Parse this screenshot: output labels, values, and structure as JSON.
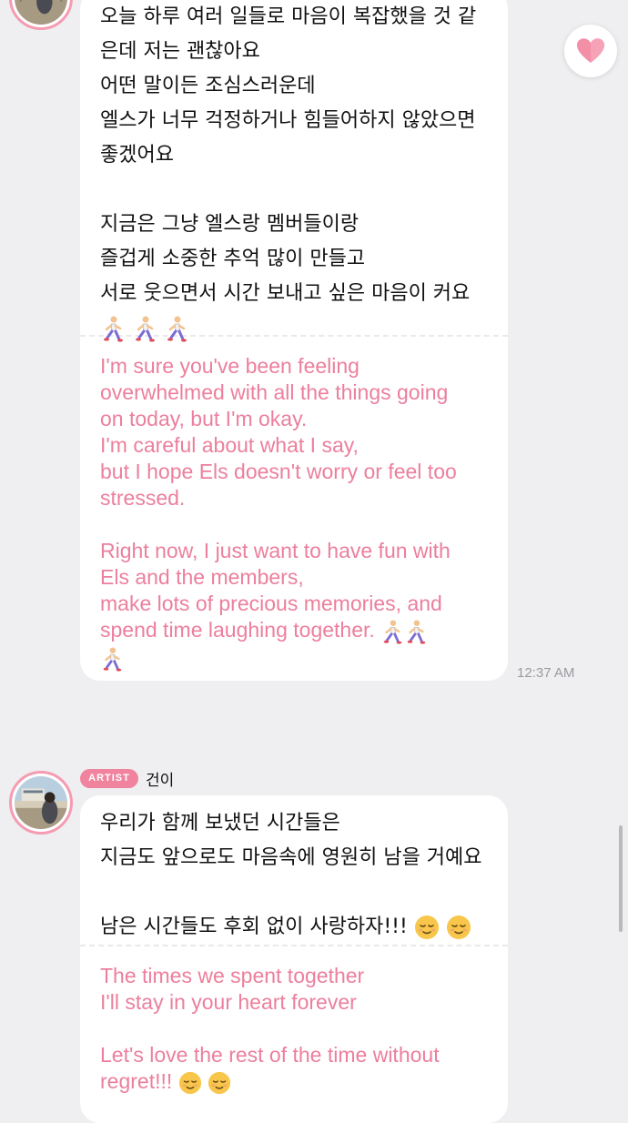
{
  "colors": {
    "background": "#efeff1",
    "bubble": "#ffffff",
    "translation_text": "#ec7f9d",
    "accent_pink": "#f0849f",
    "timestamp": "#9a9aa0"
  },
  "icons": {
    "heart": "heart-icon",
    "runner": "person-running-emoji",
    "relieved": "relieved-face-emoji"
  },
  "message1": {
    "korean_1": "오늘 하루 여러 일들로 마음이 복잡했을 것 같",
    "korean_2": "은데 저는 괜찮아요",
    "korean_3": "어떤 말이든 조심스러운데",
    "korean_4": "엘스가 너무 걱정하거나 힘들어하지 않았으면",
    "korean_5": "좋겠어요",
    "korean_6": "지금은 그냥 엘스랑 멤버들이랑",
    "korean_7": "즐겁게 소중한 추억 많이 만들고",
    "korean_8": "서로 웃으면서 시간 보내고 싶은 마음이 커요",
    "english_1": "I'm sure you've been feeling",
    "english_2": "overwhelmed with all the things going",
    "english_3": "on today, but I'm okay.",
    "english_4": "I'm careful about what I say,",
    "english_5": "but I hope Els doesn't worry or feel too",
    "english_6": "stressed.",
    "english_7": "Right now, I just want to have fun with",
    "english_8": "Els and the members,",
    "english_9": "make lots of precious memories, and",
    "english_10": "spend time laughing together.",
    "timestamp": "12:37 AM"
  },
  "message2": {
    "badge": "ARTIST",
    "sender": "건이",
    "korean_1": "우리가 함께 보냈던 시간들은",
    "korean_2": "지금도 앞으로도 마음속에 영원히 남을 거예요",
    "korean_3": "남은 시간들도 후회 없이 사랑하자!!!",
    "english_1": "The times we spent together",
    "english_2": "I'll stay in your heart forever",
    "english_3": "Let's love the rest of the time without",
    "english_4": "regret!!!"
  }
}
